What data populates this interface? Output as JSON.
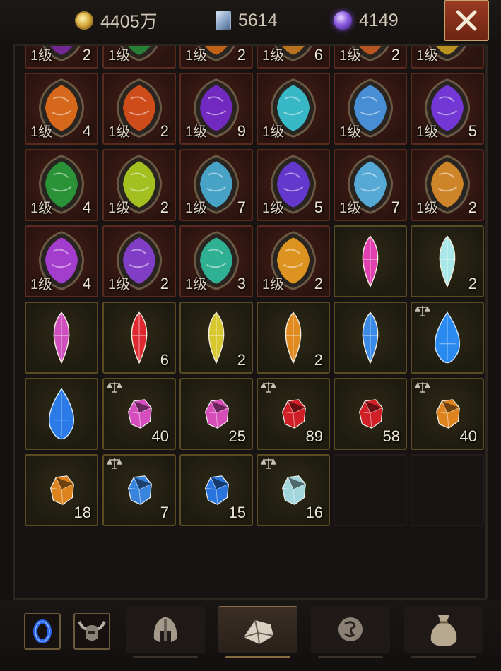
{
  "currencies": [
    {
      "icon": "gold-coin-icon",
      "value": "4405万"
    },
    {
      "icon": "card-icon",
      "value": "5614"
    },
    {
      "icon": "purple-orb-icon",
      "value": "4149"
    }
  ],
  "close_icon": "close-icon",
  "rows": [
    [
      {
        "type": "rune",
        "color": "#7a2aa0",
        "level": "1级",
        "count": "2"
      },
      {
        "type": "rune",
        "color": "#2a8a3a",
        "level": "1级",
        "count": ""
      },
      {
        "type": "rune",
        "color": "#d06a18",
        "level": "1级",
        "count": "2"
      },
      {
        "type": "rune",
        "color": "#c87a20",
        "level": "1级",
        "count": "6"
      },
      {
        "type": "rune",
        "color": "#c85a20",
        "level": "1级",
        "count": "2"
      },
      {
        "type": "rune",
        "color": "#c8a020",
        "level": "1级",
        "count": ""
      }
    ],
    [
      {
        "type": "rune",
        "color": "#e8701a",
        "level": "1级",
        "count": "4"
      },
      {
        "type": "rune",
        "color": "#e0501a",
        "level": "1级",
        "count": "2"
      },
      {
        "type": "rune",
        "color": "#7a2ad0",
        "level": "1级",
        "count": "9"
      },
      {
        "type": "rune",
        "color": "#3ac8d8",
        "level": "1级",
        "count": ""
      },
      {
        "type": "rune",
        "color": "#4a9ae8",
        "level": "1级",
        "count": ""
      },
      {
        "type": "rune",
        "color": "#7a3ae8",
        "level": "1级",
        "count": "5"
      }
    ],
    [
      {
        "type": "rune",
        "color": "#2aa03a",
        "level": "1级",
        "count": "4"
      },
      {
        "type": "rune",
        "color": "#b0d020",
        "level": "1级",
        "count": "2"
      },
      {
        "type": "rune",
        "color": "#4ab0d8",
        "level": "1级",
        "count": "7"
      },
      {
        "type": "rune",
        "color": "#6a3ae0",
        "level": "1级",
        "count": "5"
      },
      {
        "type": "rune",
        "color": "#5ab8e8",
        "level": "1级",
        "count": "7"
      },
      {
        "type": "rune",
        "color": "#e0902a",
        "level": "1级",
        "count": "2"
      }
    ],
    [
      {
        "type": "rune",
        "color": "#b040e0",
        "level": "1级",
        "count": "4"
      },
      {
        "type": "rune",
        "color": "#8a40d8",
        "level": "1级",
        "count": "2"
      },
      {
        "type": "rune",
        "color": "#30c0a0",
        "level": "1级",
        "count": "3"
      },
      {
        "type": "rune",
        "color": "#f0a020",
        "level": "1级",
        "count": "2"
      },
      {
        "type": "gem",
        "shape": "marquise",
        "color": "#e040b0",
        "level": "",
        "count": "",
        "scale": false
      },
      {
        "type": "gem",
        "shape": "marquise",
        "color": "#a8e8e8",
        "level": "",
        "count": "2",
        "scale": false
      }
    ],
    [
      {
        "type": "gem",
        "shape": "marquise",
        "color": "#d050c0",
        "level": "",
        "count": "",
        "scale": false
      },
      {
        "type": "gem",
        "shape": "marquise",
        "color": "#e02830",
        "level": "",
        "count": "6",
        "scale": false
      },
      {
        "type": "gem",
        "shape": "marquise",
        "color": "#d8c830",
        "level": "",
        "count": "2",
        "scale": false
      },
      {
        "type": "gem",
        "shape": "marquise",
        "color": "#e08a20",
        "level": "",
        "count": "2",
        "scale": false
      },
      {
        "type": "gem",
        "shape": "marquise",
        "color": "#3a8ae8",
        "level": "",
        "count": "",
        "scale": false
      },
      {
        "type": "gem",
        "shape": "drop",
        "color": "#2a8af0",
        "level": "",
        "count": "",
        "scale": true
      }
    ],
    [
      {
        "type": "gem",
        "shape": "drop",
        "color": "#2a7ae8",
        "level": "",
        "count": "",
        "scale": false
      },
      {
        "type": "gem",
        "shape": "round",
        "color": "#e050c8",
        "level": "",
        "count": "40",
        "scale": true
      },
      {
        "type": "gem",
        "shape": "round",
        "color": "#e050c0",
        "level": "",
        "count": "25",
        "scale": false
      },
      {
        "type": "gem",
        "shape": "round",
        "color": "#d82028",
        "level": "",
        "count": "89",
        "scale": true
      },
      {
        "type": "gem",
        "shape": "round",
        "color": "#d82028",
        "level": "",
        "count": "58",
        "scale": false
      },
      {
        "type": "gem",
        "shape": "round",
        "color": "#e88a20",
        "level": "",
        "count": "40",
        "scale": true
      }
    ],
    [
      {
        "type": "gem",
        "shape": "round",
        "color": "#e88a20",
        "level": "",
        "count": "18",
        "scale": false
      },
      {
        "type": "gem",
        "shape": "round",
        "color": "#3a8ae8",
        "level": "",
        "count": "7",
        "scale": true
      },
      {
        "type": "gem",
        "shape": "round",
        "color": "#2a7ae8",
        "level": "",
        "count": "15",
        "scale": false
      },
      {
        "type": "gem",
        "shape": "round",
        "color": "#a8e0e8",
        "level": "",
        "count": "16",
        "scale": true
      },
      {
        "type": "empty"
      },
      {
        "type": "empty"
      }
    ]
  ],
  "bottom": {
    "slots": [
      {
        "icon": "blue-ring-icon"
      },
      {
        "icon": "horned-helm-icon"
      }
    ],
    "tabs": [
      {
        "icon": "helmet-icon",
        "active": false
      },
      {
        "icon": "gem-bag-icon",
        "active": true
      },
      {
        "icon": "rune-icon",
        "active": false
      },
      {
        "icon": "sack-icon",
        "active": false
      }
    ]
  }
}
